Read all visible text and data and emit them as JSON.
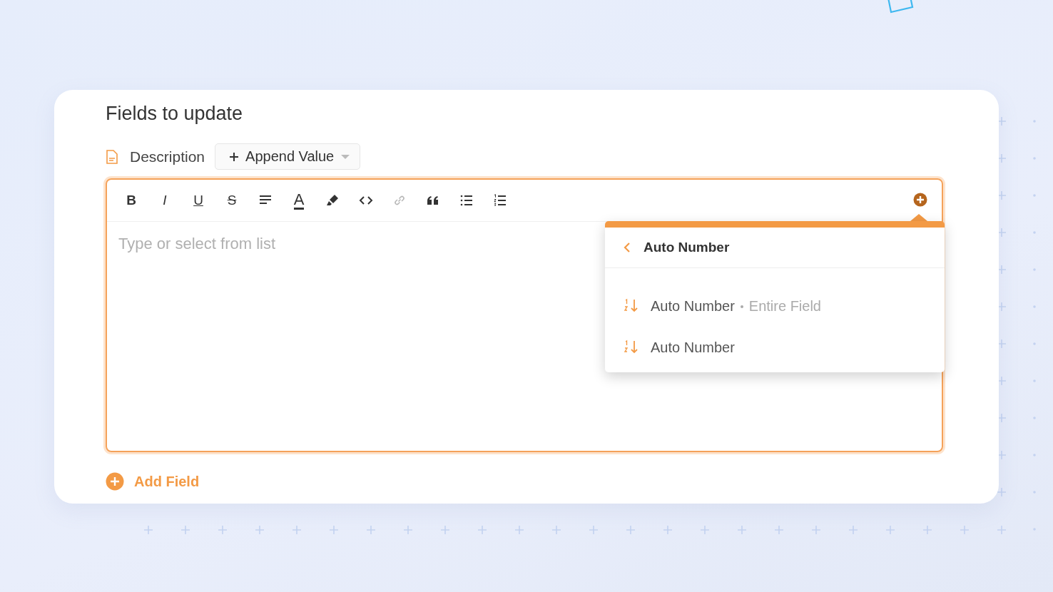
{
  "section": {
    "title": "Fields to update"
  },
  "field": {
    "name": "Description",
    "mode": "Append Value"
  },
  "toolbar": [
    {
      "kind": "bold",
      "label": "B",
      "disabled": false
    },
    {
      "kind": "italic",
      "label": "I",
      "disabled": false
    },
    {
      "kind": "underline",
      "label": "U",
      "disabled": false
    },
    {
      "kind": "strike",
      "label": "S",
      "disabled": false
    },
    {
      "kind": "align",
      "disabled": false
    },
    {
      "kind": "text-color",
      "label": "A",
      "disabled": false
    },
    {
      "kind": "highlight",
      "disabled": false
    },
    {
      "kind": "code",
      "disabled": false
    },
    {
      "kind": "link",
      "disabled": true
    },
    {
      "kind": "quote",
      "disabled": false
    },
    {
      "kind": "bullets",
      "disabled": false
    },
    {
      "kind": "numbers",
      "disabled": false
    }
  ],
  "editor": {
    "placeholder": "Type or select from list"
  },
  "menu": {
    "title": "Auto Number",
    "items": [
      {
        "label": "Auto Number",
        "detail": "Entire Field"
      },
      {
        "label": "Auto Number"
      }
    ]
  },
  "add_field": {
    "label": "Add Field"
  }
}
